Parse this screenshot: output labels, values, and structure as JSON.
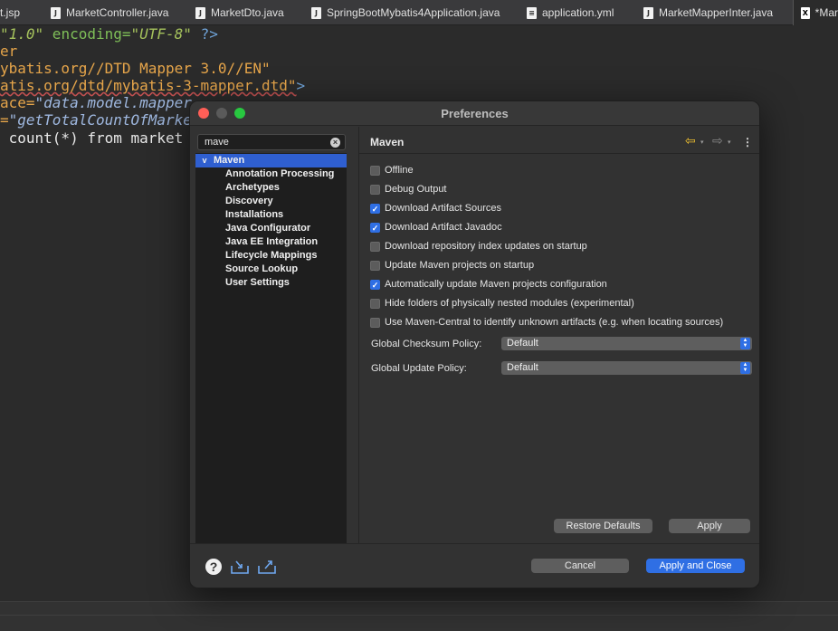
{
  "tabs": [
    {
      "label": "t.jsp",
      "icon": "jsp-file-icon"
    },
    {
      "label": "MarketController.java",
      "icon": "java-file-icon"
    },
    {
      "label": "MarketDto.java",
      "icon": "java-file-icon"
    },
    {
      "label": "SpringBootMybatis4Application.java",
      "icon": "java-file-icon"
    },
    {
      "label": "application.yml",
      "icon": "yml-file-icon"
    },
    {
      "label": "MarketMapperInter.java",
      "icon": "java-file-icon"
    },
    {
      "label": "*Mar",
      "icon": "xml-file-icon"
    }
  ],
  "editor": {
    "line1": {
      "a": "\"1.0\"",
      "b": " encoding=",
      "c": "\"UTF-8\"",
      "d": " ?>"
    },
    "line2": {
      "a": "er"
    },
    "line3": {
      "a": "ybatis.org//DTD Mapper 3.0//EN\""
    },
    "line4": {
      "a": "atis.org/dtd/mybatis-3-mapper.dtd\"",
      "b": ">"
    },
    "line5": {
      "a": "ace=",
      "b": "\"data.model.mapper"
    },
    "line6": {
      "a": "=",
      "b": "\"getTotalCountOfMarke"
    },
    "line7": {
      "a": " count(*) from market"
    }
  },
  "dialog": {
    "title": "Preferences",
    "search_value": "mave",
    "tree": {
      "root": "Maven",
      "children": [
        "Annotation Processing",
        "Archetypes",
        "Discovery",
        "Installations",
        "Java Configurator",
        "Java EE Integration",
        "Lifecycle Mappings",
        "Source Lookup",
        "User Settings"
      ]
    },
    "page_title": "Maven",
    "options": [
      {
        "label": "Offline",
        "checked": false
      },
      {
        "label": "Debug Output",
        "checked": false
      },
      {
        "label": "Download Artifact Sources",
        "checked": true
      },
      {
        "label": "Download Artifact Javadoc",
        "checked": true
      },
      {
        "label": "Download repository index updates on startup",
        "checked": false
      },
      {
        "label": "Update Maven projects on startup",
        "checked": false
      },
      {
        "label": "Automatically update Maven projects configuration",
        "checked": true
      },
      {
        "label": "Hide folders of physically nested modules (experimental)",
        "checked": false
      },
      {
        "label": "Use Maven-Central to identify unknown artifacts (e.g. when locating sources)",
        "checked": false
      }
    ],
    "checksum_label": "Global Checksum Policy:",
    "checksum_value": "Default",
    "update_label": "Global Update Policy:",
    "update_value": "Default",
    "restore_defaults": "Restore Defaults",
    "apply": "Apply",
    "cancel": "Cancel",
    "apply_close": "Apply and Close",
    "checkmark": "✓",
    "clear_glyph": "×",
    "help_glyph": "?",
    "chevron_glyph": "v",
    "back_glyph": "⇦",
    "forward_glyph": "⇨",
    "dropdown_glyph": "▾",
    "menu_glyph": "⋮",
    "select_arrow_up": "▲",
    "select_arrow_down": "▼"
  },
  "colors": {
    "accent": "#2f6fe4",
    "dialog_bg": "#323232",
    "editor_bg": "#2b2b2b"
  }
}
